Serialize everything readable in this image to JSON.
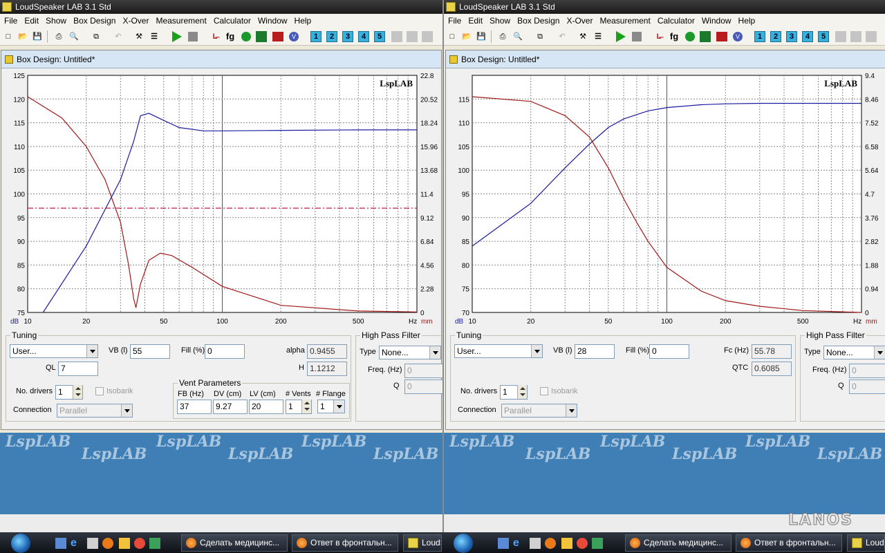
{
  "app_title": "LoudSpeaker LAB 3.1 Std",
  "menu": [
    "File",
    "Edit",
    "Show",
    "Box Design",
    "X-Over",
    "Measurement",
    "Calculator",
    "Window",
    "Help"
  ],
  "toolbar": {
    "number_buttons": [
      "1",
      "2",
      "3",
      "4",
      "5"
    ],
    "fg_label": "fg",
    "v_label": "V"
  },
  "panes": [
    {
      "window_title": "Box Design: Untitled*",
      "plot": {
        "brand": "LspLAB",
        "y_left_ticks": [
          "125",
          "120",
          "115",
          "110",
          "105",
          "100",
          "95",
          "90",
          "85",
          "80",
          "75"
        ],
        "y_right_ticks": [
          "22.8",
          "20.52",
          "18.24",
          "15.96",
          "13.68",
          "11.4",
          "9.12",
          "6.84",
          "4.56",
          "2.28",
          "0"
        ],
        "x_ticks": [
          "10",
          "20",
          "50",
          "100",
          "200",
          "500"
        ],
        "x_unit": "Hz",
        "y_left_unit": "dB",
        "y_right_unit": "mm"
      },
      "tuning": {
        "legend": "Tuning",
        "mode": "User...",
        "vb_label": "VB (l)",
        "vb_value": "55",
        "fill_label": "Fill (%)",
        "fill_value": "0",
        "p1_label": "alpha",
        "p1_value": "0.9455",
        "ql_label": "QL",
        "ql_value": "7",
        "p2_label": "H",
        "p2_value": "1.1212",
        "drivers_label": "No. drivers",
        "drivers_value": "1",
        "isobarik_label": "Isobarik",
        "connection_label": "Connection",
        "connection_value": "Parallel"
      },
      "vent": {
        "legend": "Vent Parameters",
        "fb_label": "FB (Hz)",
        "fb_value": "37",
        "dv_label": "DV (cm)",
        "dv_value": "9.27",
        "lv_label": "LV (cm)",
        "lv_value": "20",
        "vents_label": "# Vents",
        "vents_value": "1",
        "flange_label": "# Flange",
        "flange_value": "1"
      },
      "hpf": {
        "legend": "High Pass Filter",
        "type_label": "Type",
        "type_value": "None...",
        "freq_label": "Freq. (Hz)",
        "freq_value": "0",
        "q_label": "Q",
        "q_value": "0"
      }
    },
    {
      "window_title": "Box Design: Untitled*",
      "plot": {
        "brand": "LspLAB",
        "y_left_ticks": [
          "",
          "115",
          "110",
          "105",
          "100",
          "95",
          "90",
          "85",
          "80",
          "75",
          "70"
        ],
        "y_right_ticks": [
          "9.4",
          "8.46",
          "7.52",
          "6.58",
          "5.64",
          "4.7",
          "3.76",
          "2.82",
          "1.88",
          "0.94",
          "0"
        ],
        "x_ticks": [
          "10",
          "20",
          "50",
          "100",
          "200",
          "500"
        ],
        "x_unit": "Hz",
        "y_left_unit": "dB",
        "y_right_unit": "mm"
      },
      "tuning": {
        "legend": "Tuning",
        "mode": "User...",
        "vb_label": "VB (l)",
        "vb_value": "28",
        "fill_label": "Fill (%)",
        "fill_value": "0",
        "p1_label": "Fc (Hz)",
        "p1_value": "55.78",
        "p2_label": "QTC",
        "p2_value": "0.6085",
        "drivers_label": "No. drivers",
        "drivers_value": "1",
        "isobarik_label": "Isobarik",
        "connection_label": "Connection",
        "connection_value": "Parallel"
      },
      "hpf": {
        "legend": "High Pass Filter",
        "type_label": "Type",
        "type_value": "None...",
        "freq_label": "Freq. (Hz)",
        "freq_value": "0",
        "q_label": "Q",
        "q_value": "0"
      }
    }
  ],
  "desktop": {
    "watermark": "LspLAB"
  },
  "taskbar": {
    "tasks": [
      {
        "label": "Сделать медицинс..."
      },
      {
        "label": "Ответ в фронтальн..."
      },
      {
        "label": "LoudS"
      }
    ],
    "right_tasks": [
      {
        "label": "Сделать медицинс..."
      },
      {
        "label": "Ответ в фронтальн..."
      },
      {
        "label": "Loud"
      }
    ],
    "corner_logo": "LANOS"
  },
  "chart_data": [
    {
      "type": "line",
      "x_scale": "log",
      "xlim": [
        10,
        1000
      ],
      "ylim": [
        75,
        125
      ],
      "y2lim": [
        0,
        22.8
      ],
      "grid": true,
      "series": [
        {
          "color": "#1a1aa0",
          "axis": "left",
          "x": [
            12,
            20,
            30,
            35,
            38,
            42,
            50,
            60,
            80,
            100,
            200,
            500,
            1000
          ],
          "values": [
            75,
            89,
            103,
            111,
            116.5,
            117,
            115.5,
            114,
            113.3,
            113.3,
            113.4,
            113.5,
            113.5
          ]
        },
        {
          "color": "#a01818",
          "axis": "left",
          "x": [
            10,
            15,
            20,
            25,
            30,
            33,
            35,
            36,
            38,
            42,
            48,
            55,
            70,
            100,
            200,
            500,
            1000
          ],
          "values": [
            120.5,
            116,
            110,
            103,
            94,
            85,
            78,
            76,
            81,
            86,
            87.5,
            87,
            84.5,
            80.5,
            76.5,
            75.3,
            75.1
          ]
        },
        {
          "color": "#c21a4a",
          "axis": "left",
          "dashed": true,
          "x": [
            10,
            1000
          ],
          "values": [
            97,
            97
          ]
        }
      ]
    },
    {
      "type": "line",
      "x_scale": "log",
      "xlim": [
        10,
        1000
      ],
      "ylim": [
        70,
        120
      ],
      "y2lim": [
        0,
        9.4
      ],
      "grid": true,
      "series": [
        {
          "color": "#1a1aa0",
          "axis": "left",
          "x": [
            10,
            20,
            30,
            40,
            50,
            60,
            80,
            100,
            150,
            200,
            300,
            500,
            1000
          ],
          "values": [
            84,
            93,
            100.5,
            105.5,
            109,
            110.8,
            112.5,
            113.2,
            113.8,
            114,
            114.1,
            114.1,
            114.1
          ]
        },
        {
          "color": "#a01818",
          "axis": "left",
          "x": [
            10,
            20,
            30,
            40,
            50,
            60,
            70,
            80,
            100,
            150,
            200,
            300,
            500,
            1000
          ],
          "values": [
            115.5,
            114.5,
            111.5,
            107,
            100.5,
            94,
            89,
            85,
            79.5,
            74.5,
            72.5,
            71.3,
            70.4,
            70
          ]
        }
      ]
    }
  ]
}
